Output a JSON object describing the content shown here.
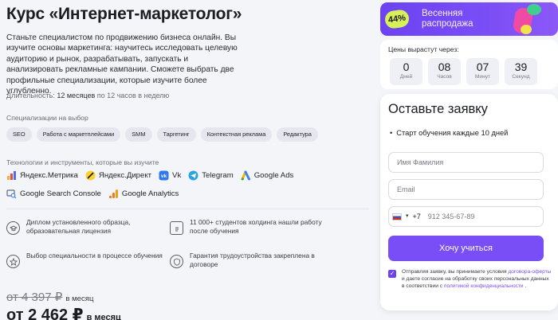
{
  "course": {
    "title": "Курс «Интернет-маркетолог»",
    "description": "Станьте специалистом по продвижению бизнеса онлайн. Вы изучите основы маркетинга: научитесь исследовать целевую аудиторию и рынок, разрабатывать, запускать и анализировать рекламные кампании. Сможете выбрать две профильные специализации, которые изучите более углубленно.",
    "duration_label": "Длительность:",
    "duration_value": "12 месяцев",
    "duration_extra": "по 12 часов в неделю"
  },
  "specializations": {
    "label": "Специализации на выбор",
    "items": [
      "SEO",
      "Работа с маркетплейсами",
      "SMM",
      "Таргетинг",
      "Контекстная реклама",
      "Редактура"
    ]
  },
  "tools": {
    "label": "Технологии и инструменты, которые вы изучите",
    "items": [
      {
        "name": "Яндекс.Метрика",
        "icon": "yandex-metrica-icon"
      },
      {
        "name": "Яндекс.Директ",
        "icon": "yandex-direct-icon"
      },
      {
        "name": "Vk",
        "icon": "vk-icon"
      },
      {
        "name": "Telegram",
        "icon": "telegram-icon"
      },
      {
        "name": "Google Ads",
        "icon": "google-ads-icon"
      },
      {
        "name": "Google Search Console",
        "icon": "google-search-console-icon"
      },
      {
        "name": "Google Analytics",
        "icon": "google-analytics-icon"
      }
    ]
  },
  "features": [
    {
      "text": "Диплом установленного образца, образовательная лицензия",
      "icon": "graduation-cap-icon"
    },
    {
      "text": "11 000+ студентов холдинга нашли работу после обучения",
      "icon": "clipboard-icon"
    },
    {
      "text": "Выбор специальности в процессе обучения",
      "icon": "star-icon"
    },
    {
      "text": "Гарантия трудоустройства закреплена в договоре",
      "icon": "shield-icon"
    }
  ],
  "price": {
    "old": "от 4 397 ₽",
    "new": "от 2 462 ₽",
    "per": "в месяц"
  },
  "promo": {
    "discount": "44%",
    "text_line1": "Весенняя",
    "text_line2": "распродажа",
    "accent": "#7a4ef6",
    "badge_color": "#d7f05a"
  },
  "timer": {
    "label": "Цены вырастут через:",
    "units": [
      {
        "value": "0",
        "unit": "Дней"
      },
      {
        "value": "08",
        "unit": "Часов"
      },
      {
        "value": "07",
        "unit": "Минут"
      },
      {
        "value": "39",
        "unit": "Секунд"
      }
    ]
  },
  "form": {
    "title": "Оставьте заявку",
    "bullet": "Старт обучения каждые 10 дней",
    "name_placeholder": "Имя Фамилия",
    "email_placeholder": "Email",
    "phone_code": "+7",
    "phone_placeholder": "912 345-67-89",
    "submit_label": "Хочу учиться",
    "consent_before": "Отправляя заявку, вы принимаете условия ",
    "consent_link1": "договора-оферты",
    "consent_middle": " и даете согласие на обработку своих персональных данных в соответствии с ",
    "consent_link2": "политикой конфиденциальности",
    "consent_after": " ."
  }
}
